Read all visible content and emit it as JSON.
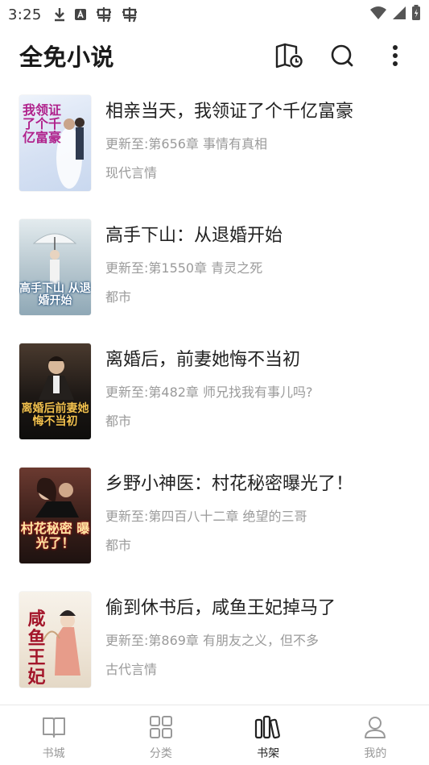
{
  "status_bar": {
    "time": "3:25",
    "left_icons": [
      "download-icon",
      "a-icon",
      "bug-icon",
      "bug-icon"
    ],
    "right_icons": [
      "wifi-icon",
      "signal-icon",
      "battery-icon"
    ]
  },
  "header": {
    "title": "全免小说",
    "actions": [
      "library-icon",
      "search-icon",
      "more-icon"
    ]
  },
  "books": [
    {
      "title": "相亲当天，我领证了个千亿富豪",
      "update": "更新至:第656章 事情有真相",
      "genre": "现代言情",
      "cover_text": "我领证了个千亿富豪",
      "cover_colors": [
        "#eef3fb",
        "#c9d8ef"
      ],
      "cover_text_color": "#b0228c"
    },
    {
      "title": "高手下山：从退婚开始",
      "update": "更新至:第1550章 青灵之死",
      "genre": "都市",
      "cover_text": "高手下山 从退婚开始",
      "cover_colors": [
        "#e3ebee",
        "#8fa8b6"
      ],
      "cover_text_color": "#ffffff"
    },
    {
      "title": "离婚后，前妻她悔不当初",
      "update": "更新至:第482章 师兄找我有事儿吗?",
      "genre": "都市",
      "cover_text": "离婚后前妻她 悔不当初",
      "cover_colors": [
        "#3a3028",
        "#0e0d0c"
      ],
      "cover_text_color": "#f2c14e"
    },
    {
      "title": "乡野小神医：村花秘密曝光了！",
      "update": "更新至:第四百八十二章 绝望的三哥",
      "genre": "都市",
      "cover_text": "村花秘密 曝光了！",
      "cover_colors": [
        "#5a2a25",
        "#1e1210"
      ],
      "cover_text_color": "#ffe7a3"
    },
    {
      "title": "偷到休书后，咸鱼王妃掉马了",
      "update": "更新至:第869章 有朋友之义，但不多",
      "genre": "古代言情",
      "cover_text": "咸鱼王妃",
      "cover_colors": [
        "#f4efe6",
        "#e4d8c6"
      ],
      "cover_text_color": "#a3152a"
    }
  ],
  "bottom_nav": [
    {
      "label": "书城",
      "icon": "book-open-icon",
      "active": false
    },
    {
      "label": "分类",
      "icon": "grid-icon",
      "active": false
    },
    {
      "label": "书架",
      "icon": "bookshelf-icon",
      "active": true
    },
    {
      "label": "我的",
      "icon": "person-icon",
      "active": false
    }
  ]
}
